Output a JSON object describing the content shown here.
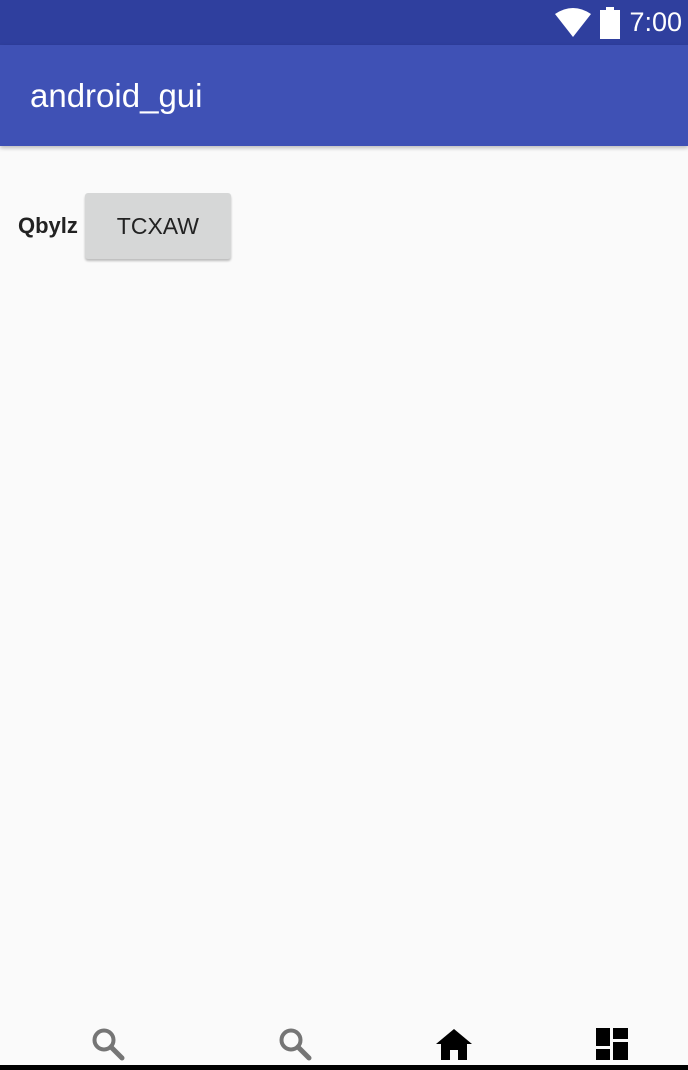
{
  "status_bar": {
    "time": "7:00",
    "icons": [
      "wifi-icon",
      "battery-icon"
    ]
  },
  "app_bar": {
    "title": "android_gui"
  },
  "main": {
    "label": "Qbylz",
    "button_label": "TCXAW"
  },
  "bottom_nav": {
    "items": [
      "search-icon",
      "search-icon",
      "home-icon",
      "dashboard-icon"
    ]
  },
  "colors": {
    "status_bar": "#2f3f9e",
    "app_bar": "#3f51b5",
    "button": "#d6d7d7",
    "background": "#fafafa"
  }
}
